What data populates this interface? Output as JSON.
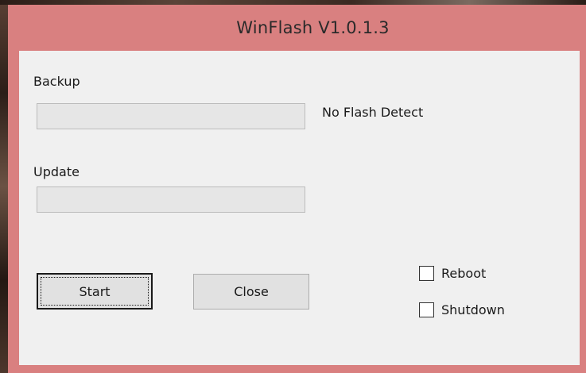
{
  "window": {
    "title": "WinFlash V1.0.1.3"
  },
  "backup": {
    "label": "Backup",
    "progress": 0,
    "status": "No Flash Detect"
  },
  "update": {
    "label": "Update",
    "progress": 0
  },
  "buttons": {
    "start": "Start",
    "close": "Close"
  },
  "options": {
    "reboot": {
      "label": "Reboot",
      "checked": false
    },
    "shutdown": {
      "label": "Shutdown",
      "checked": false
    }
  },
  "colors": {
    "titlebar": "#d98080",
    "client": "#f0f0f0"
  }
}
